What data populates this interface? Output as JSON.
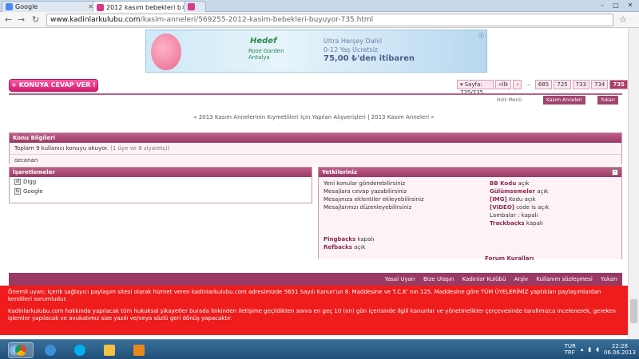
{
  "browser": {
    "tabs": [
      {
        "title": "Google",
        "active": false
      },
      {
        "title": "2012 kasım bebekleri b",
        "active": true
      },
      {
        "title": "",
        "active": false
      }
    ],
    "url_host": "www.kadinlarkulubu.com",
    "url_path": "/kasim-anneleri/569255-2012-kasim-bebekleri-buyuyor-735.html",
    "window_controls": [
      "–",
      "□",
      "✕"
    ]
  },
  "banner": {
    "brand": "Hedef",
    "brand_sub": "Rose Garden",
    "brand_sub2": "Antalya",
    "line1": "Ultra Herşey Dahil",
    "line2": "0-12 Yaş Ücretsiz",
    "price": "75,00 ₺'den itibaren"
  },
  "toolbar": {
    "reply_label": "+ KONUYA CEVAP VER !",
    "page_label": "▾ Sayfa: 735/735",
    "first_label": "«İlk",
    "prev_label": "‹",
    "ellipsis": "...",
    "pages": [
      "685",
      "725",
      "733",
      "734",
      "735"
    ],
    "quick_menu": "Hızlı Menü",
    "kasim_anneleri": "Kasım Anneleri",
    "yukari": "Yukarı"
  },
  "thread_nav": {
    "prev": "« 2013 Kasım Annelerinin Kıymetlileri İçin Yapılan Alışverişleri",
    "sep": " | ",
    "next": "2013 Kasım Anneleri »"
  },
  "konu": {
    "title": "Konu Bilgileri",
    "line": "Toplam 9 kullanıcı konuyu okuyor.",
    "line_muted": "(1 üye ve 8 ziyaretçi)",
    "user": "ozcanan"
  },
  "isaretlemeler": {
    "title": "İşaretlemeler",
    "items": [
      {
        "label": "Digg",
        "icon": "digg-icon"
      },
      {
        "label": "Google",
        "icon": "google-icon"
      }
    ]
  },
  "yetkiler": {
    "title": "Yetkileriniz",
    "left": [
      "Yeni konular gönderebilirsiniz",
      "Mesajlara cevap yazabilirsiniz",
      "Mesajınıza eklentiler ekleyebilirsiniz",
      "Mesajlarınızı düzenleyebilirsiniz"
    ],
    "right": [
      {
        "b": "BB Kodu",
        "t": " açık"
      },
      {
        "b": "Gülümsemeler",
        "t": " açık"
      },
      {
        "b": "[IMG]",
        "t": " Kodu açık"
      },
      {
        "b": "[VIDEO]",
        "t": " code is açık"
      },
      {
        "b": "",
        "t": "Lambalar : kapalı"
      },
      {
        "b": "Trackbacks",
        "t": " kapalı"
      }
    ],
    "extra": [
      {
        "b": "Pingbacks",
        "t": " kapalı"
      },
      {
        "b": "Refbacks",
        "t": " açık"
      }
    ],
    "rules": "Forum Kuralları"
  },
  "footer_links": [
    "Yasal Uyarı",
    "Bize Ulaşın",
    "Kadınlar Kulübü",
    "Arşiv",
    "Kullanım sözleşmesi",
    "Yukarı"
  ],
  "warning": {
    "p1": "Önemli uyarı; içerik sağlayıcı paylaşım sitesi olarak hizmet veren kadinlarkulubu.com adresimizde 5651 Sayılı Kanun'un 8. Maddesine ve T.C.K' nın 125. Maddesine göre TÜM ÜYELERİMİZ yaptıkları paylaşımlardan kendileri sorumludur.",
    "p2": "Kadinlarkulubu.com hakkında yapılacak tüm hukuksal şikayetler burada linkinden iletişime geçildikten sonra en geç 10 (on) gün içerisinde ilgili kanunlar ve yönetmelikler çerçevesinde tarafımızca incelenerek, gereken işlemler yapılacak ve avukatımız size yazılı ve/veya sözlü geri dönüş yapacaktır."
  },
  "taskbar": {
    "lang": "TUR\nTRF",
    "time": "22:28",
    "date": "06.06.2013"
  }
}
